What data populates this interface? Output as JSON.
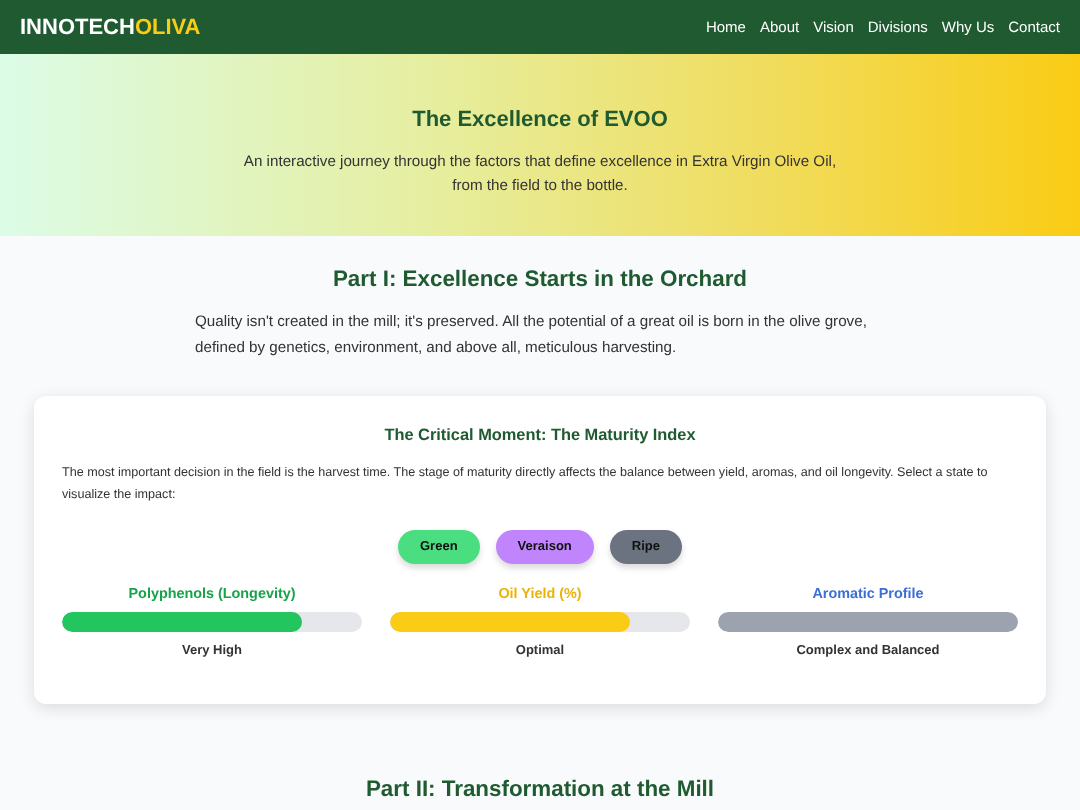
{
  "nav": {
    "logo_main": "INNOTECH",
    "logo_accent": "OLIVA",
    "links": [
      "Home",
      "About",
      "Vision",
      "Divisions",
      "Why Us",
      "Contact"
    ]
  },
  "hero": {
    "title": "The Excellence of EVOO",
    "subtitle": "An interactive journey through the factors that define excellence in Extra Virgin Olive Oil, from the field to the bottle."
  },
  "part1": {
    "title": "Part I: Excellence Starts in the Orchard",
    "text": "Quality isn't created in the mill; it's preserved. All the potential of a great oil is born in the olive grove, defined by genetics, environment, and above all, meticulous harvesting."
  },
  "card": {
    "title": "The Critical Moment: The Maturity Index",
    "text": "The most important decision in the field is the harvest time. The stage of maturity directly affects the balance between yield, aromas, and oil longevity. Select a state to visualize the impact:",
    "states": [
      {
        "label": "Green",
        "color": "#4ade80"
      },
      {
        "label": "Veraison",
        "color": "#c084fc"
      },
      {
        "label": "Ripe",
        "color": "#6b7280"
      }
    ],
    "meters": [
      {
        "label": "Polyphenols (Longevity)",
        "color": "#16a34a",
        "level": 0.8,
        "reading": "Very High"
      },
      {
        "label": "Oil Yield (%)",
        "color": "#eab308",
        "level": 0.8,
        "reading": "Optimal"
      },
      {
        "label": "Aromatic Profile",
        "color": "#3b6fd4",
        "level": 1,
        "reading": "Complex and Balanced"
      }
    ]
  },
  "part2": {
    "title": "Part II: Transformation at the Mill"
  }
}
